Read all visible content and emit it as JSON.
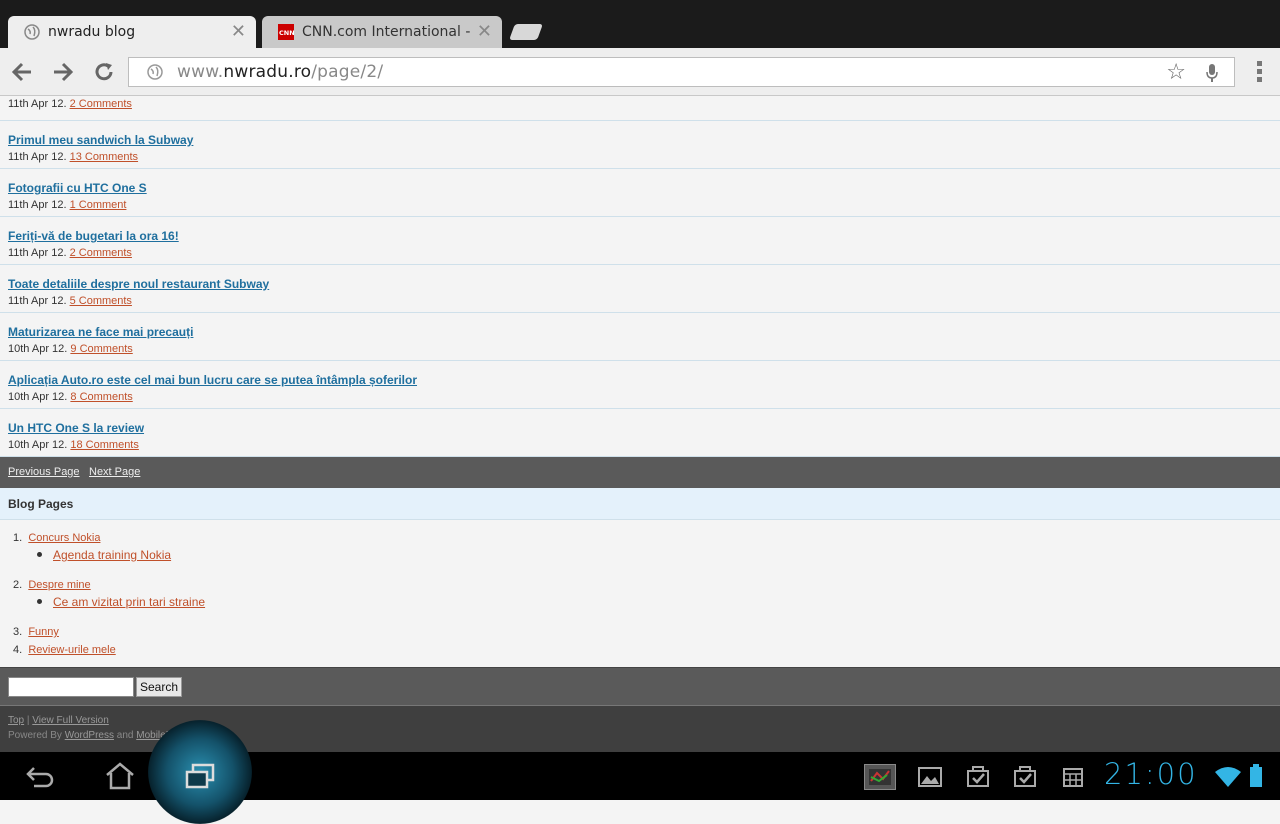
{
  "browser": {
    "tabs": [
      {
        "title": "nwradu blog",
        "active": true,
        "icon": "globe-icon"
      },
      {
        "title": "CNN.com International -",
        "active": false,
        "icon": "cnn-favicon",
        "favicon_text": "CNN"
      }
    ],
    "url": {
      "prefix": "www.",
      "domain": "nwradu.ro",
      "path": "/page/2/"
    }
  },
  "posts": [
    {
      "title": "",
      "date": "11th Apr 12.",
      "comments": "2 Comments"
    },
    {
      "title": "Primul meu sandwich la Subway",
      "date": "11th Apr 12.",
      "comments": "13 Comments"
    },
    {
      "title": "Fotografii cu HTC One S",
      "date": "11th Apr 12.",
      "comments": "1 Comment"
    },
    {
      "title": "Feriți-vă de bugetari la ora 16!",
      "date": "11th Apr 12.",
      "comments": "2 Comments"
    },
    {
      "title": "Toate detaliile despre noul restaurant Subway",
      "date": "11th Apr 12.",
      "comments": "5 Comments"
    },
    {
      "title": "Maturizarea ne face mai precauți",
      "date": "10th Apr 12.",
      "comments": "9 Comments"
    },
    {
      "title": "Aplicația Auto.ro este cel mai bun lucru care se putea întâmpla șoferilor",
      "date": "10th Apr 12.",
      "comments": "8 Comments"
    },
    {
      "title": "Un HTC One S la review",
      "date": "10th Apr 12.",
      "comments": "18 Comments"
    }
  ],
  "pager": {
    "previous": "Previous Page",
    "next": "Next Page"
  },
  "blog_pages": {
    "heading": "Blog Pages",
    "items": [
      {
        "num": "1.",
        "label": "Concurs Nokia",
        "sub": "Agenda training Nokia"
      },
      {
        "num": "2.",
        "label": "Despre mine",
        "sub": "Ce am vizitat prin tari straine"
      },
      {
        "num": "3.",
        "label": "Funny"
      },
      {
        "num": "4.",
        "label": "Review-urile mele"
      }
    ]
  },
  "search": {
    "button": "Search",
    "value": ""
  },
  "footer": {
    "top": "Top",
    "sep": " | ",
    "full": "View Full Version",
    "powered": "Powered By ",
    "wordpress": "WordPress",
    "and": " and ",
    "mobilepress": "MobilePress",
    "end": "."
  },
  "system": {
    "clock": "21:00"
  },
  "colors": {
    "link": "#1f6f9e",
    "comment_link": "#c0502a",
    "clock": "#33b5e5"
  }
}
